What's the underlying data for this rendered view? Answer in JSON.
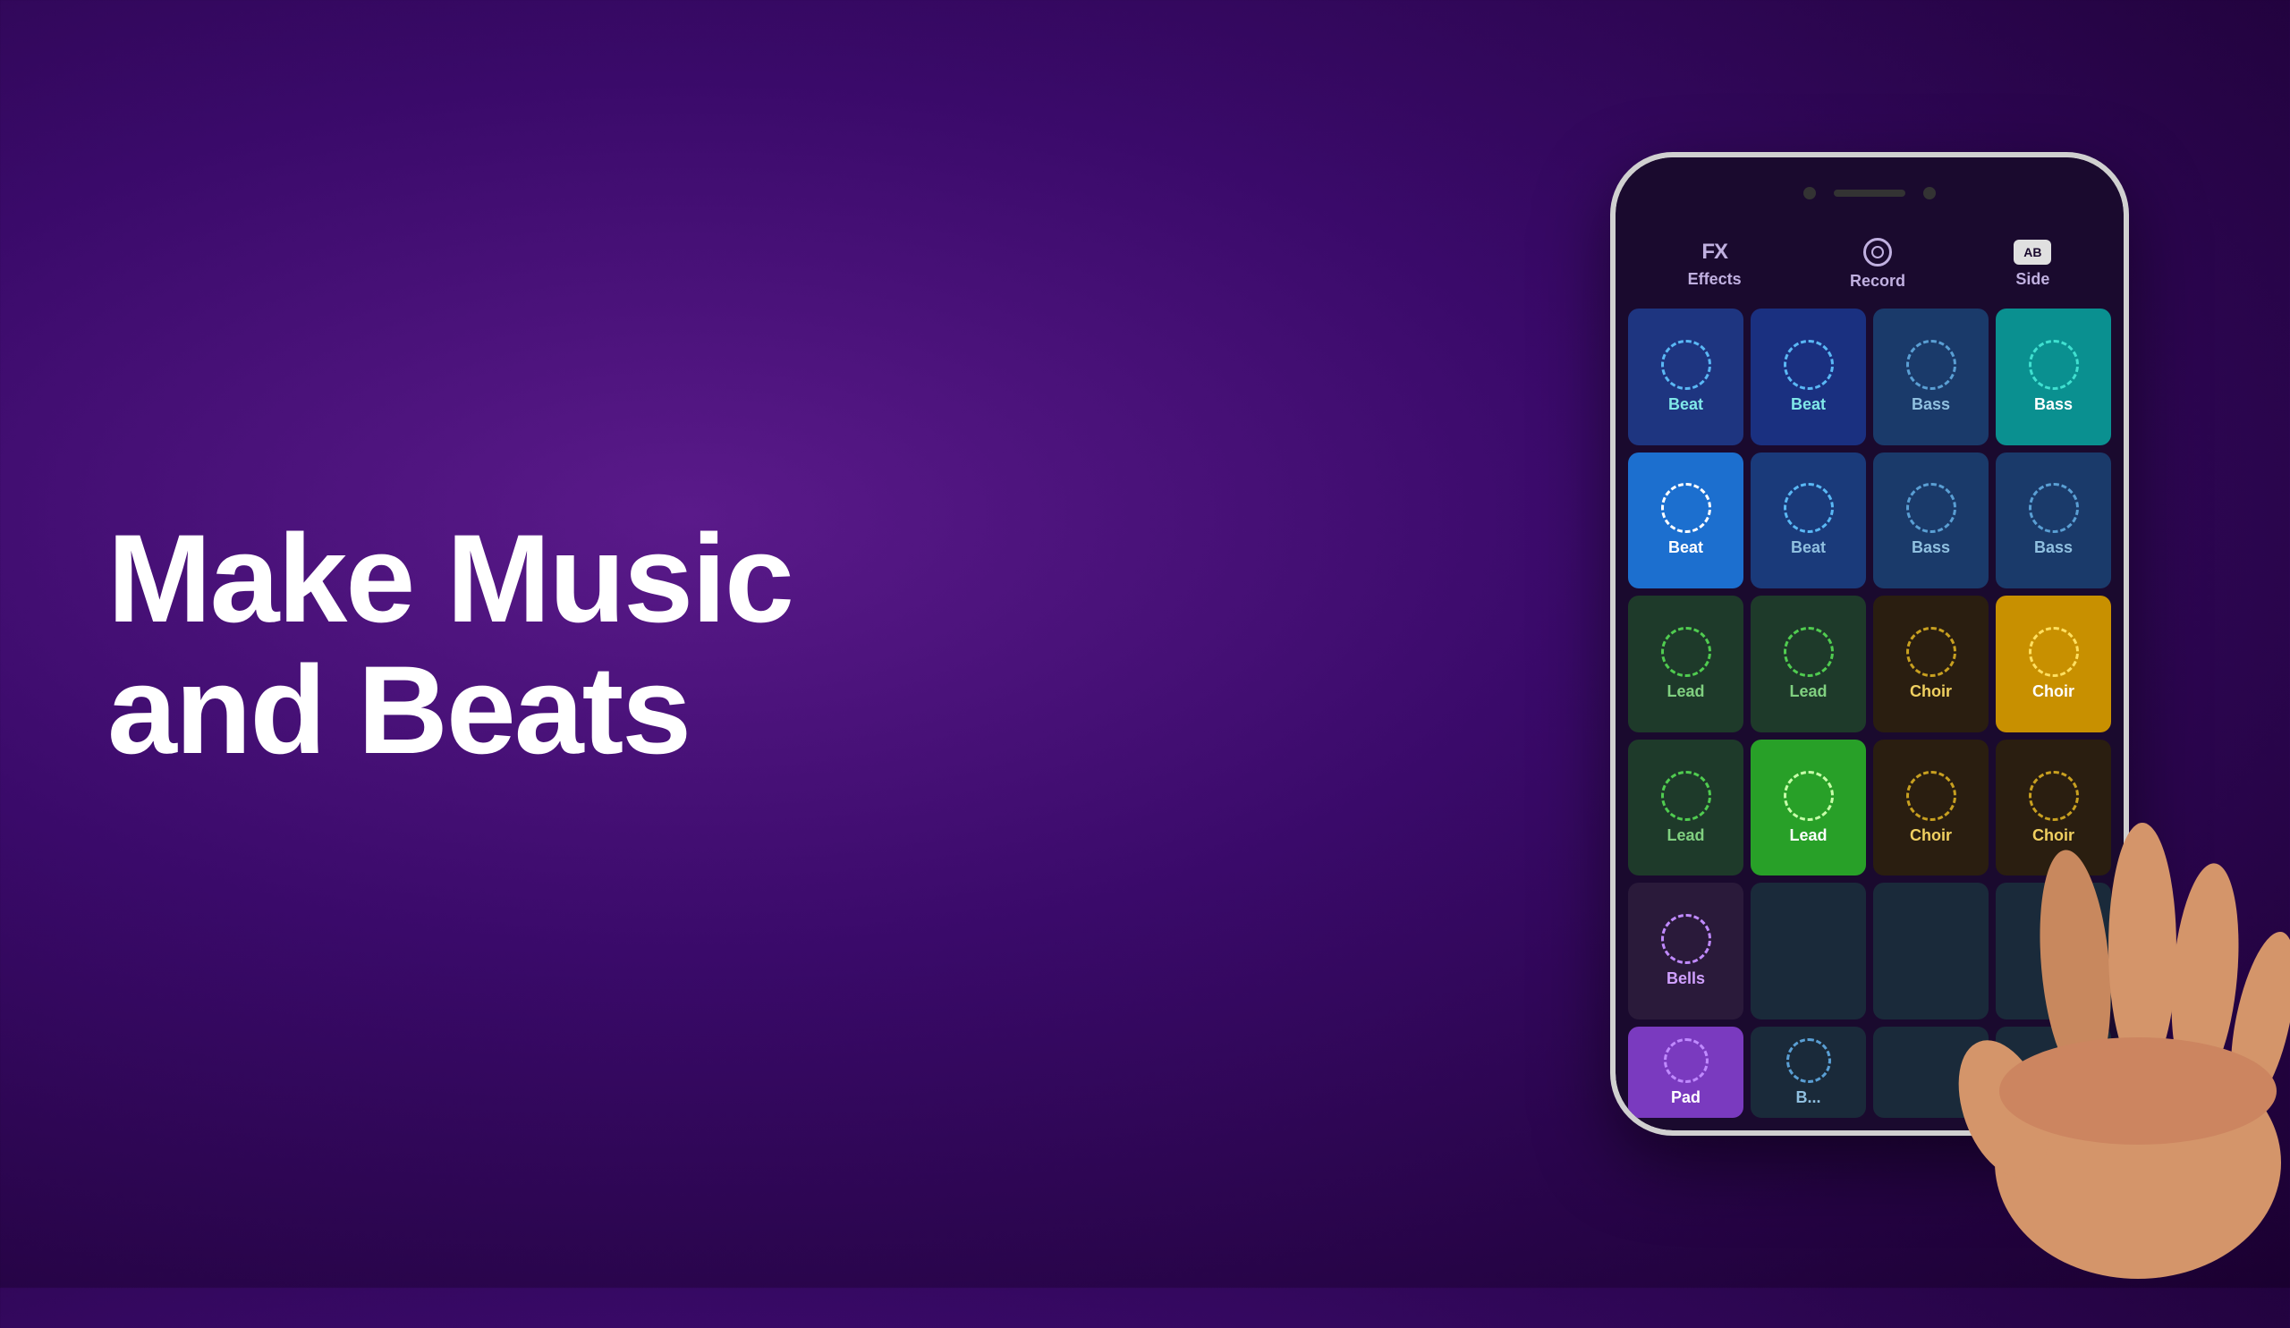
{
  "headline": {
    "line1": "Make Music",
    "line2": "and Beats"
  },
  "toolbar": {
    "effects_icon": "FX",
    "effects_label": "Effects",
    "record_label": "Record",
    "side_label": "Side",
    "ab_icon": "AB"
  },
  "grid": {
    "rows": [
      [
        {
          "label": "Beat",
          "color_class": "r1c1",
          "circle_class": "pad-circle-blue-bright",
          "text_class": "text-cyan"
        },
        {
          "label": "Beat",
          "color_class": "r1c2",
          "circle_class": "pad-circle-blue-bright",
          "text_class": "text-cyan"
        },
        {
          "label": "Bass",
          "color_class": "r1c3",
          "circle_class": "pad-circle-dark-blue",
          "text_class": "text-blue-light"
        },
        {
          "label": "Bass",
          "color_class": "r1c4",
          "circle_class": "pad-circle-teal",
          "text_class": "text-white"
        }
      ],
      [
        {
          "label": "Beat",
          "color_class": "r2c1",
          "circle_class": "pad-circle-royal",
          "text_class": "text-white"
        },
        {
          "label": "Beat",
          "color_class": "r2c2",
          "circle_class": "pad-circle-blue-bright",
          "text_class": "text-blue-light"
        },
        {
          "label": "Bass",
          "color_class": "r2c3",
          "circle_class": "pad-circle-dark-blue",
          "text_class": "text-blue-light"
        },
        {
          "label": "Bass",
          "color_class": "r2c4",
          "circle_class": "pad-circle-dark-blue",
          "text_class": "text-blue-light"
        }
      ],
      [
        {
          "label": "Lead",
          "color_class": "r3c1",
          "circle_class": "pad-circle-green",
          "text_class": "text-green-light"
        },
        {
          "label": "Lead",
          "color_class": "r3c2",
          "circle_class": "pad-circle-green",
          "text_class": "text-green-light"
        },
        {
          "label": "Choir",
          "color_class": "r3c3",
          "circle_class": "pad-circle-olive",
          "text_class": "text-yellow-light"
        },
        {
          "label": "Choir",
          "color_class": "r3c4",
          "circle_class": "pad-circle-yellow",
          "text_class": "text-white"
        }
      ],
      [
        {
          "label": "Lead",
          "color_class": "r4c1",
          "circle_class": "pad-circle-green",
          "text_class": "text-green-light"
        },
        {
          "label": "Lead",
          "color_class": "r4c2",
          "circle_class": "pad-circle-green-bright",
          "text_class": "text-white"
        },
        {
          "label": "Choir",
          "color_class": "r4c3",
          "circle_class": "pad-circle-brown",
          "text_class": "text-yellow-light"
        },
        {
          "label": "Choir",
          "color_class": "r4c4",
          "circle_class": "pad-circle-brown",
          "text_class": "text-yellow-light"
        }
      ],
      [
        {
          "label": "Bells",
          "color_class": "r5c1",
          "circle_class": "pad-circle-purple",
          "text_class": "text-purple-light"
        },
        {
          "label": "",
          "color_class": "r5c2",
          "circle_class": "",
          "text_class": ""
        },
        {
          "label": "",
          "color_class": "r5c3",
          "circle_class": "",
          "text_class": ""
        },
        {
          "label": "",
          "color_class": "r5c4",
          "circle_class": "",
          "text_class": ""
        }
      ]
    ],
    "partial_row": [
      {
        "label": "Pad",
        "color_class": "r6c1",
        "circle_class": "pad-circle-purple",
        "text_class": "text-white"
      },
      {
        "label": "B...",
        "color_class": "r6c2",
        "circle_class": "pad-circle-dark-blue",
        "text_class": "text-blue-light"
      },
      {
        "label": "",
        "color_class": "r5c3",
        "circle_class": "",
        "text_class": ""
      },
      {
        "label": "",
        "color_class": "r5c4",
        "circle_class": "",
        "text_class": ""
      }
    ]
  }
}
